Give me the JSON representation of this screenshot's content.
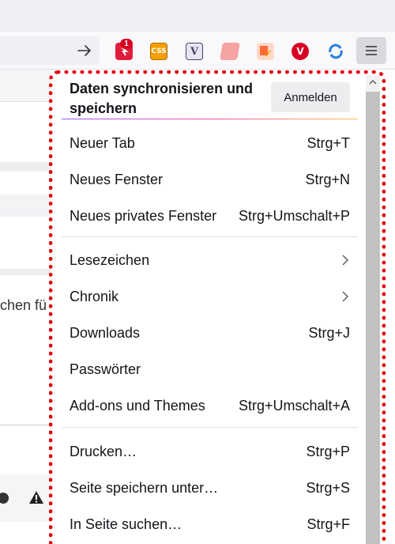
{
  "toolbar": {
    "extension_badge": "1",
    "extensions": [
      {
        "name": "notification-extension",
        "color": "#e01e3c"
      },
      {
        "name": "css-extension",
        "label": "CSS",
        "color": "#f59f00"
      },
      {
        "name": "v-extension",
        "label": "V",
        "color": "#4b3f6b"
      },
      {
        "name": "scroll-extension",
        "color": "#f08080"
      },
      {
        "name": "edit-extension",
        "color": "#ff6b35"
      },
      {
        "name": "vivaldi-extension",
        "label": "V",
        "color": "#d70022"
      },
      {
        "name": "sync-extension",
        "color": "#2a7de1"
      }
    ]
  },
  "background": {
    "partial_text": "chen fü"
  },
  "menu": {
    "sync_title": "Daten synchronisieren und speichern",
    "signin_label": "Anmelden",
    "items": [
      {
        "label": "Neuer Tab",
        "shortcut": "Strg+T"
      },
      {
        "label": "Neues Fenster",
        "shortcut": "Strg+N"
      },
      {
        "label": "Neues privates Fenster",
        "shortcut": "Strg+Umschalt+P"
      },
      {
        "label": "Lesezeichen",
        "shortcut": ""
      },
      {
        "label": "Chronik",
        "shortcut": ""
      },
      {
        "label": "Downloads",
        "shortcut": "Strg+J"
      },
      {
        "label": "Passwörter",
        "shortcut": ""
      },
      {
        "label": "Add-ons und Themes",
        "shortcut": "Strg+Umschalt+A"
      },
      {
        "label": "Drucken…",
        "shortcut": "Strg+P"
      },
      {
        "label": "Seite speichern unter…",
        "shortcut": "Strg+S"
      },
      {
        "label": "In Seite suchen…",
        "shortcut": "Strg+F"
      }
    ]
  },
  "colors": {
    "highlight_outline": "#e2000d",
    "accent_gradient": [
      "#9059ff",
      "#ff4aa2",
      "#ffbd4f"
    ]
  }
}
